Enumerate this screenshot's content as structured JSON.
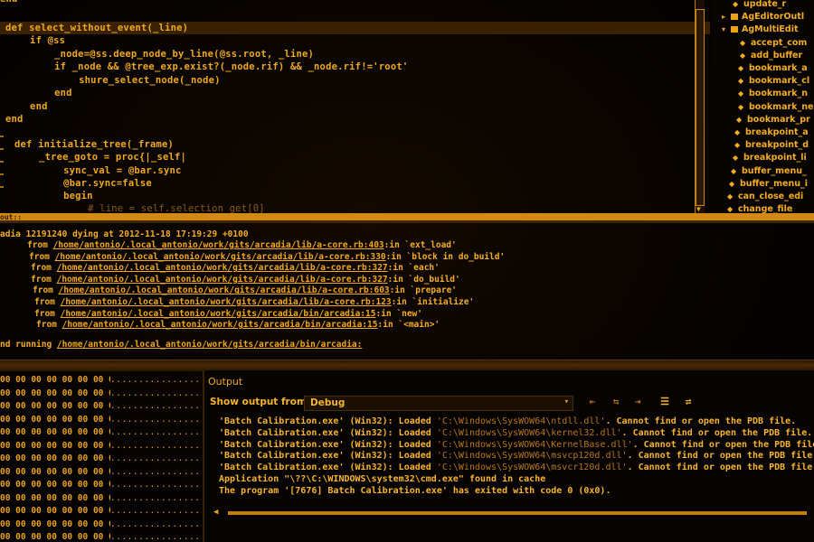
{
  "editor": {
    "lines": [
      {
        "text": "end",
        "cls": ""
      },
      {
        "text": "def select_without_event(_line)",
        "cls": "hl"
      },
      {
        "text": "  if @ss",
        "cls": ""
      },
      {
        "text": "    _node=@ss.deep_node_by_line(@ss.root, _line)",
        "cls": ""
      },
      {
        "text": "    if _node && @tree_exp.exist?(_node.rif) && _node.rif!='root'",
        "cls": ""
      },
      {
        "text": "      shure_select_node(_node)",
        "cls": ""
      },
      {
        "text": "    end",
        "cls": ""
      },
      {
        "text": "  end",
        "cls": ""
      },
      {
        "text": "end",
        "cls": ""
      },
      {
        "text": "",
        "cls": ""
      },
      {
        "text": "def initialize_tree(_frame)",
        "cls": ""
      },
      {
        "text": "  _tree_goto = proc{|_self|",
        "cls": ""
      },
      {
        "text": "    sync_val = @bar.sync",
        "cls": ""
      },
      {
        "text": "    @bar.sync=false",
        "cls": ""
      },
      {
        "text": "    begin",
        "cls": ""
      },
      {
        "text": "      # line = self.selection_get[0]",
        "cls": "dim"
      }
    ]
  },
  "tree": {
    "items": [
      {
        "label": "update_r",
        "expander": "",
        "icon": "method"
      },
      {
        "label": "AgEditorOutl",
        "expander": "▸",
        "icon": "node"
      },
      {
        "label": "AgMultiEdit",
        "expander": "▾",
        "icon": "node"
      },
      {
        "label": "accept_com",
        "expander": "",
        "icon": "method"
      },
      {
        "label": "add_buffer",
        "expander": "",
        "icon": "method"
      },
      {
        "label": "bookmark_a",
        "expander": "",
        "icon": "method"
      },
      {
        "label": "bookmark_cl",
        "expander": "",
        "icon": "method"
      },
      {
        "label": "bookmark_n",
        "expander": "",
        "icon": "method"
      },
      {
        "label": "bookmark_ne",
        "expander": "",
        "icon": "method"
      },
      {
        "label": "bookmark_pr",
        "expander": "",
        "icon": "method"
      },
      {
        "label": "breakpoint_a",
        "expander": "",
        "icon": "method"
      },
      {
        "label": "breakpoint_d",
        "expander": "",
        "icon": "method"
      },
      {
        "label": "breakpoint_li",
        "expander": "",
        "icon": "method"
      },
      {
        "label": "buffer_menu_",
        "expander": "",
        "icon": "method"
      },
      {
        "label": "buffer_menu_i",
        "expander": "",
        "icon": "method"
      },
      {
        "label": "can_close_edi",
        "expander": "",
        "icon": "method"
      },
      {
        "label": "change_file",
        "expander": "",
        "icon": "method"
      }
    ]
  },
  "divider_label": "out::",
  "error_output": {
    "header": "adia 12191240 dying at 2012-11-18 17:19:29 +0100",
    "frames": [
      {
        "prefix": "from ",
        "path": "/home/antonio/.local_antonio/work/gits/arcadia/lib/a-core.rb:403",
        "suffix": ":in `ext_load'"
      },
      {
        "prefix": "from ",
        "path": "/home/antonio/.local_antonio/work/gits/arcadia/lib/a-core.rb:330",
        "suffix": ":in `block in do_build'"
      },
      {
        "prefix": "from ",
        "path": "/home/antonio/.local_antonio/work/gits/arcadia/lib/a-core.rb:327",
        "suffix": ":in `each'"
      },
      {
        "prefix": "from ",
        "path": "/home/antonio/.local_antonio/work/gits/arcadia/lib/a-core.rb:327",
        "suffix": ":in `do_build'"
      },
      {
        "prefix": "from ",
        "path": "/home/antonio/.local_antonio/work/gits/arcadia/lib/a-core.rb:603",
        "suffix": ":in `prepare'"
      },
      {
        "prefix": "from ",
        "path": "/home/antonio/.local_antonio/work/gits/arcadia/lib/a-core.rb:123",
        "suffix": ":in `initialize'"
      },
      {
        "prefix": "from ",
        "path": "/home/antonio/.local_antonio/work/gits/arcadia/bin/arcadia:15",
        "suffix": ":in `new'"
      },
      {
        "prefix": "from ",
        "path": "/home/antonio/.local_antonio/work/gits/arcadia/bin/arcadia:15",
        "suffix": ":in `<main>'"
      }
    ],
    "end_prefix": "nd running ",
    "end_path": "/home/antonio/.local_antonio/work/gits/arcadia/bin/arcadia:"
  },
  "dots": {
    "grid_row": "00 00 00 00 00 00 00 00",
    "col_row": "................."
  },
  "output_panel": {
    "title": "Output",
    "show_label": "Show output from:",
    "show_value": "Debug",
    "log": [
      {
        "a": "'Batch Calibration.exe' (Win32): Loaded ",
        "b": "'C:\\Windows\\SysWOW64\\ntdll.dll'",
        "c": ". Cannot find or open the PDB file."
      },
      {
        "a": "'Batch Calibration.exe' (Win32): Loaded ",
        "b": "'C:\\Windows\\SysWOW64\\kernel32.dll'",
        "c": ". Cannot find or open the PDB file."
      },
      {
        "a": "'Batch Calibration.exe' (Win32): Loaded ",
        "b": "'C:\\Windows\\SysWOW64\\KernelBase.dll'",
        "c": ". Cannot find or open the PDB file."
      },
      {
        "a": "'Batch Calibration.exe' (Win32): Loaded ",
        "b": "'C:\\Windows\\SysWOW64\\msvcp120d.dll'",
        "c": ". Cannot find or open the PDB file."
      },
      {
        "a": "'Batch Calibration.exe' (Win32): Loaded ",
        "b": "'C:\\Windows\\SysWOW64\\msvcr120d.dll'",
        "c": ". Cannot find or open the PDB file."
      },
      {
        "a": "Application \"\\??\\C:\\WINDOWS\\system32\\cmd.exe\" found in cache",
        "b": "",
        "c": ""
      },
      {
        "a": "The program '[7676] Batch Calibration.exe' has exited with code 0 (0x0).",
        "b": "",
        "c": ""
      }
    ]
  },
  "colors": {
    "accent": "#e9a21a",
    "bar": "#d28a14",
    "background": "#000000"
  }
}
